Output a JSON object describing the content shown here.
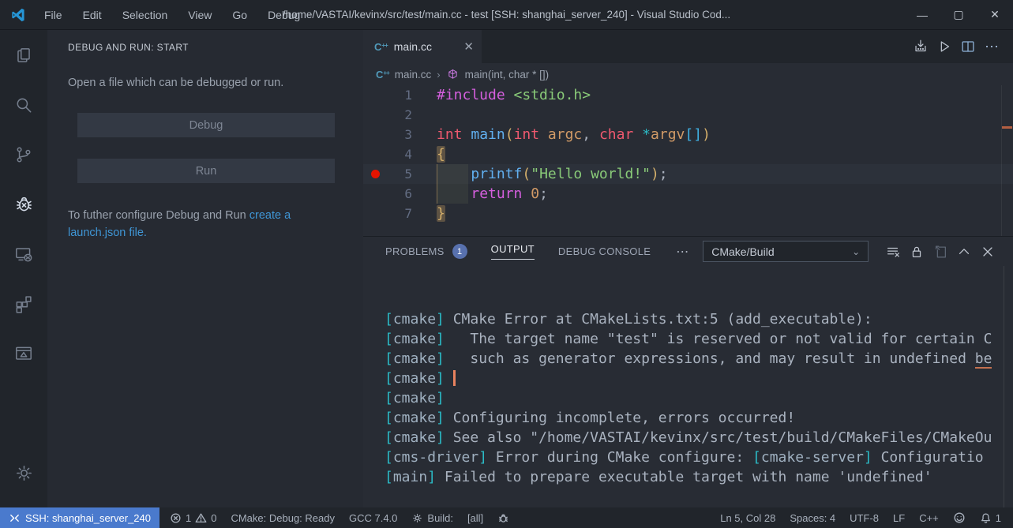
{
  "window": {
    "title": "/home/VASTAI/kevinx/src/test/main.cc - test [SSH: shanghai_server_240] - Visual Studio Cod...",
    "menus": [
      "File",
      "Edit",
      "Selection",
      "View",
      "Go",
      "Debug",
      "⋯"
    ],
    "controls": {
      "minimize": "—",
      "maximize": "▢",
      "close": "✕"
    }
  },
  "activity_bar": {
    "items": [
      "explorer",
      "search",
      "source-control",
      "run-and-debug",
      "remote-explorer",
      "extensions",
      "cmake-tools",
      "settings"
    ],
    "active_item": "run-and-debug"
  },
  "sidebar": {
    "header": "DEBUG AND RUN: START",
    "message": "Open a file which can be debugged or run.",
    "debug_button": "Debug",
    "run_button": "Run",
    "footer_text": "To futher configure Debug and Run ",
    "footer_link": "create a launch.json file."
  },
  "editor": {
    "tab": {
      "label": "main.cc",
      "close_glyph": "✕",
      "language_icon": "cpp"
    },
    "actions": [
      "build-install",
      "run",
      "split-editor",
      "more-actions"
    ],
    "breadcrumb": {
      "file": "main.cc",
      "separator": "›",
      "symbol": "main(int, char * [])"
    },
    "active_line": 5,
    "breakpoint_line": 5,
    "cursor_position": "Ln 5, Col 28",
    "code_lines": [
      [
        [
          "#include",
          "pp"
        ],
        [
          " ",
          "pun"
        ],
        [
          "<stdio.h>",
          "str"
        ]
      ],
      [],
      [
        [
          "int",
          "kw"
        ],
        [
          " ",
          "pun"
        ],
        [
          "main",
          "fn"
        ],
        [
          "(",
          "par"
        ],
        [
          "int",
          "kw"
        ],
        [
          " ",
          "pun"
        ],
        [
          "argc",
          "var"
        ],
        [
          ", ",
          "pun"
        ],
        [
          "char",
          "kw"
        ],
        [
          " ",
          "pun"
        ],
        [
          "*",
          "cy"
        ],
        [
          "argv",
          "var"
        ],
        [
          "[]",
          "sqr"
        ],
        [
          ")",
          "par"
        ]
      ],
      [
        [
          "{",
          "brace"
        ]
      ],
      [
        [
          "    ",
          "pun"
        ],
        [
          "printf",
          "fn"
        ],
        [
          "(",
          "par"
        ],
        [
          "\"Hello world!\"",
          "str"
        ],
        [
          ")",
          "par"
        ],
        [
          ";",
          "pun"
        ]
      ],
      [
        [
          "    ",
          "pun"
        ],
        [
          "return",
          "pp"
        ],
        [
          " ",
          "pun"
        ],
        [
          "0",
          "var"
        ],
        [
          ";",
          "pun"
        ]
      ],
      [
        [
          "}",
          "brace"
        ]
      ]
    ]
  },
  "panel": {
    "tabs": [
      {
        "label": "PROBLEMS",
        "badge": "1",
        "active": false
      },
      {
        "label": "OUTPUT",
        "active": true
      },
      {
        "label": "DEBUG CONSOLE",
        "active": false
      }
    ],
    "more_glyph": "⋯",
    "channel_select": "CMake/Build",
    "chevron_glyph": "⌄",
    "icons": [
      "clear-output",
      "scroll-lock",
      "open-output-in-editor",
      "maximize-panel",
      "close-panel"
    ],
    "output_lines": [
      [
        [
          "[",
          "ob"
        ],
        [
          "cmake",
          "tg"
        ],
        [
          "]",
          "ob"
        ],
        [
          " CMake Error at CMakeLists.txt:5 (add_executable):",
          "txt"
        ]
      ],
      [
        [
          "[",
          "ob"
        ],
        [
          "cmake",
          "tg"
        ],
        [
          "]",
          "ob"
        ],
        [
          "   The target name \"test\" is reserved or not valid for certain C",
          "txt"
        ]
      ],
      [
        [
          "[",
          "ob"
        ],
        [
          "cmake",
          "tg"
        ],
        [
          "]",
          "ob"
        ],
        [
          "   such as generator expressions, and may result in undefined ",
          "txt"
        ],
        [
          "be",
          "und"
        ]
      ],
      [
        [
          "[",
          "ob"
        ],
        [
          "cmake",
          "tg"
        ],
        [
          "]",
          "ob"
        ],
        [
          " ",
          "txt"
        ],
        [
          "",
          "cur"
        ]
      ],
      [
        [
          "[",
          "ob"
        ],
        [
          "cmake",
          "tg"
        ],
        [
          "]",
          "ob"
        ]
      ],
      [
        [
          "[",
          "ob"
        ],
        [
          "cmake",
          "tg"
        ],
        [
          "]",
          "ob"
        ],
        [
          " Configuring incomplete, errors occurred!",
          "txt"
        ]
      ],
      [
        [
          "[",
          "ob"
        ],
        [
          "cmake",
          "tg"
        ],
        [
          "]",
          "ob"
        ],
        [
          " See also \"/home/VASTAI/kevinx/src/test/build/CMakeFiles/CMakeOu",
          "txt"
        ]
      ],
      [
        [
          "[",
          "ob"
        ],
        [
          "cms-driver",
          "tg"
        ],
        [
          "]",
          "ob"
        ],
        [
          " Error during CMake configure: ",
          "txt"
        ],
        [
          "[",
          "ob"
        ],
        [
          "cmake-server",
          "tg"
        ],
        [
          "]",
          "ob"
        ],
        [
          " Configuratio",
          "txt"
        ]
      ],
      [
        [
          "[",
          "ob"
        ],
        [
          "main",
          "tg"
        ],
        [
          "]",
          "ob"
        ],
        [
          " Failed to prepare executable target with name 'undefined'",
          "txt"
        ]
      ]
    ]
  },
  "status_bar": {
    "remote": "SSH: shanghai_server_240",
    "errors": "1",
    "warnings": "0",
    "cmake_status": "CMake: Debug: Ready",
    "compiler": "GCC 7.4.0",
    "build_label": "Build:",
    "build_target": "[all]",
    "cursor": "Ln 5, Col 28",
    "indent": "Spaces: 4",
    "encoding": "UTF-8",
    "eol": "LF",
    "language": "C++",
    "notification_count": "1"
  },
  "colors": {
    "remote_accent": "#4a7acd",
    "link": "#3f96d6",
    "badge": "#5871ae",
    "breakpoint": "#e51400",
    "error_marker": "#b35f42",
    "output_tag": "#2bbac5",
    "editor_bg": "#282c34",
    "chrome_bg": "#21252b",
    "sidebar_bg": "#262a32"
  }
}
